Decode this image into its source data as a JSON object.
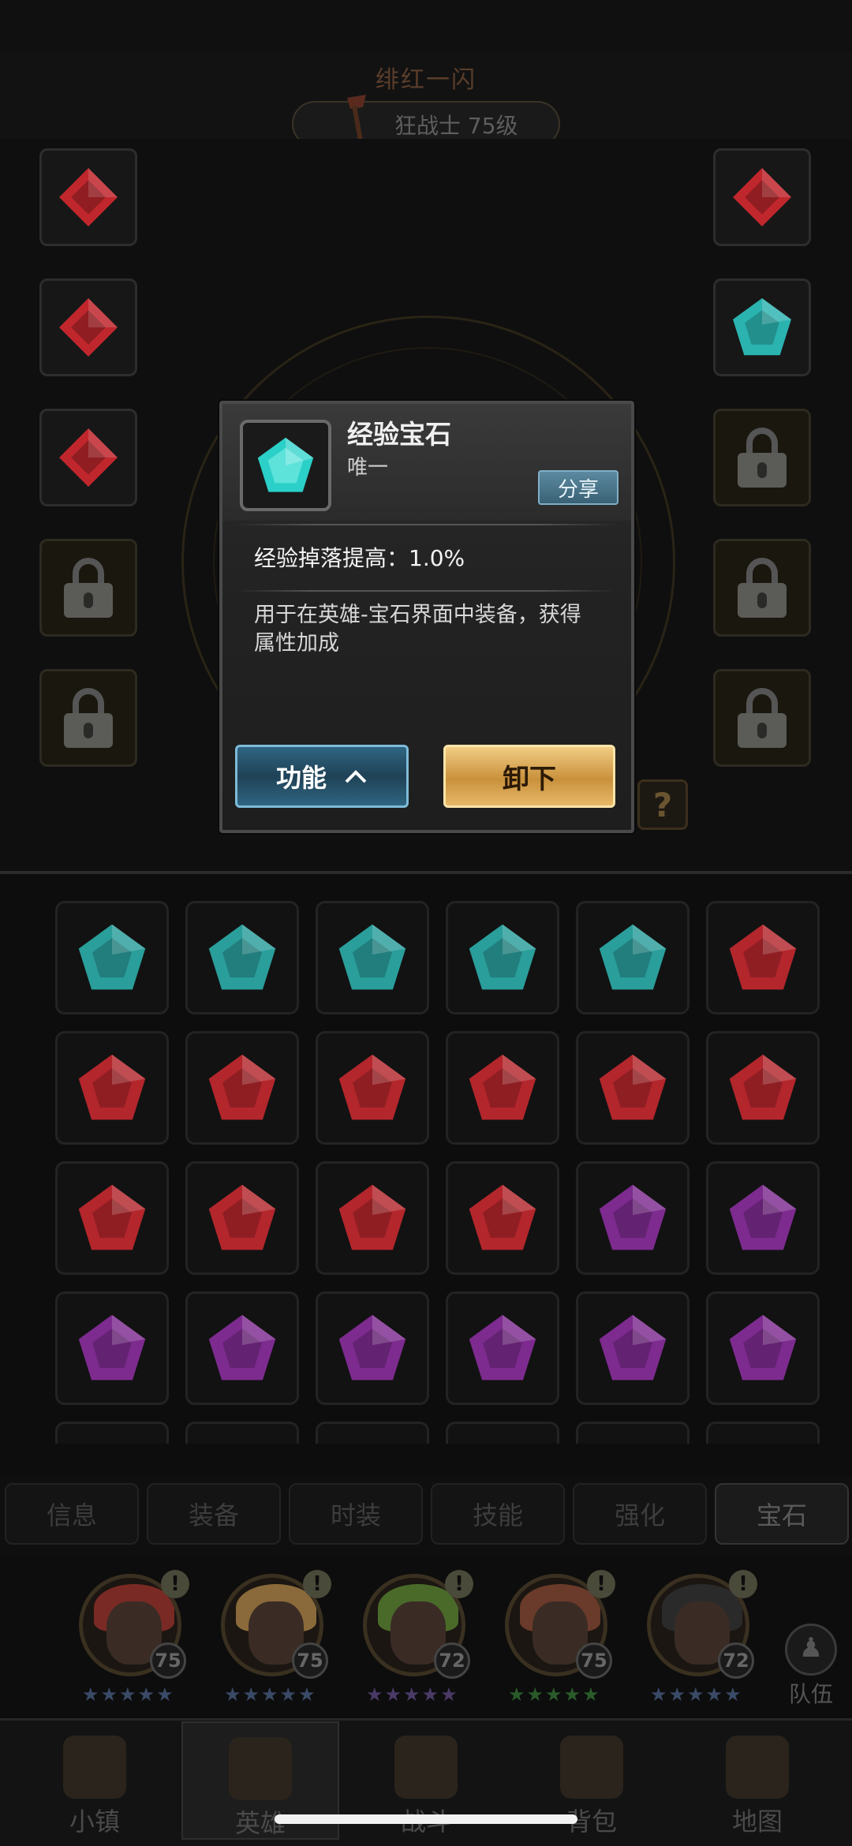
{
  "header": {
    "hero_name": "绯红一闪",
    "class_level": "狂战士 75级"
  },
  "left_slots": [
    {
      "state": "gem",
      "color": "#c0272d"
    },
    {
      "state": "gem",
      "color": "#c0272d"
    },
    {
      "state": "gem",
      "color": "#c0272d"
    },
    {
      "state": "locked"
    },
    {
      "state": "locked"
    }
  ],
  "right_slots": [
    {
      "state": "gem",
      "color": "#c0272d"
    },
    {
      "state": "gem",
      "color": "#2bb3b0"
    },
    {
      "state": "locked"
    },
    {
      "state": "locked"
    },
    {
      "state": "locked"
    }
  ],
  "help_label": "?",
  "popup": {
    "item_name": "经验宝石",
    "rarity": "唯一",
    "share_label": "分享",
    "stat": "经验掉落提高：1.0%",
    "description": "用于在英雄-宝石界面中装备，获得属性加成",
    "function_label": "功能",
    "unequip_label": "卸下",
    "gem_color": "#2bd0c8"
  },
  "gem_grid": [
    [
      "#2a9e9b",
      "#2a9e9b",
      "#2a9e9b",
      "#2a9e9b",
      "#2a9e9b",
      "#b3262c"
    ],
    [
      "#b3262c",
      "#b3262c",
      "#b3262c",
      "#b3262c",
      "#b3262c",
      "#b3262c"
    ],
    [
      "#b3262c",
      "#b3262c",
      "#b3262c",
      "#b3262c",
      "#7d2b8f",
      "#7d2b8f"
    ],
    [
      "#7d2b8f",
      "#7d2b8f",
      "#7d2b8f",
      "#7d2b8f",
      "#7d2b8f",
      "#7d2b8f"
    ]
  ],
  "tabs": [
    {
      "label": "信息",
      "active": false
    },
    {
      "label": "装备",
      "active": false
    },
    {
      "label": "时装",
      "active": false
    },
    {
      "label": "技能",
      "active": false
    },
    {
      "label": "强化",
      "active": false
    },
    {
      "label": "宝石",
      "active": true
    }
  ],
  "heroes": [
    {
      "level": "75",
      "stars": "★★★★★",
      "star_color": "#3a4a66",
      "hair": "#7a2a24",
      "alert": "!"
    },
    {
      "level": "75",
      "stars": "★★★★★",
      "star_color": "#3a4a66",
      "hair": "#8a6a3a",
      "alert": "!"
    },
    {
      "level": "72",
      "stars": "★★★★★",
      "star_color": "#4a3a66",
      "hair": "#4a6a2a",
      "alert": "!"
    },
    {
      "level": "75",
      "stars": "★★★★★",
      "star_color": "#2a5a2a",
      "hair": "#6a3a2a",
      "alert": "!"
    },
    {
      "level": "72",
      "stars": "★★★★★",
      "star_color": "#3a4a66",
      "hair": "#2a2a2a",
      "alert": "!"
    }
  ],
  "team_label": "队伍",
  "nav": [
    {
      "label": "小镇",
      "active": false
    },
    {
      "label": "英雄",
      "active": true
    },
    {
      "label": "战斗",
      "active": false
    },
    {
      "label": "背包",
      "active": false
    },
    {
      "label": "地图",
      "active": false
    }
  ]
}
